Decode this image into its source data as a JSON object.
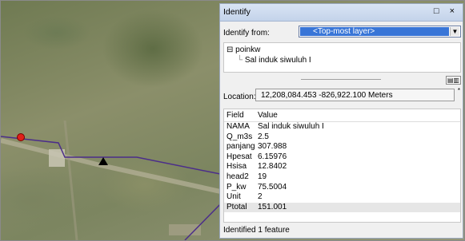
{
  "window": {
    "title": "Identify",
    "controls": "□ ×"
  },
  "identify_from": {
    "label": "Identify from:",
    "selected": "<Top-most layer>"
  },
  "tree": {
    "layer": "poinkw",
    "feature": "Sal induk siwuluh I",
    "expander": "⊟"
  },
  "location": {
    "label": "Location:",
    "value": "12,208,084.453  -826,922.100 Meters"
  },
  "grid": {
    "headers": [
      "Field",
      "Value"
    ],
    "rows": [
      {
        "field": "NAMA",
        "value": "Sal induk siwuluh I"
      },
      {
        "field": "Q_m3s",
        "value": "2.5"
      },
      {
        "field": "panjang",
        "value": "307.988"
      },
      {
        "field": "Hpesat",
        "value": "6.15976"
      },
      {
        "field": "Hsisa",
        "value": "12.8402"
      },
      {
        "field": "head2",
        "value": "19"
      },
      {
        "field": "P_kw",
        "value": "75.5004"
      },
      {
        "field": "Unit",
        "value": "2"
      },
      {
        "field": "Ptotal",
        "value": "151.001"
      }
    ]
  },
  "status": "Identified 1 feature",
  "colors": {
    "line": "#4b2d8a",
    "point_red": "#e0201a",
    "triangle": "#000000",
    "selection": "#3875d7"
  }
}
